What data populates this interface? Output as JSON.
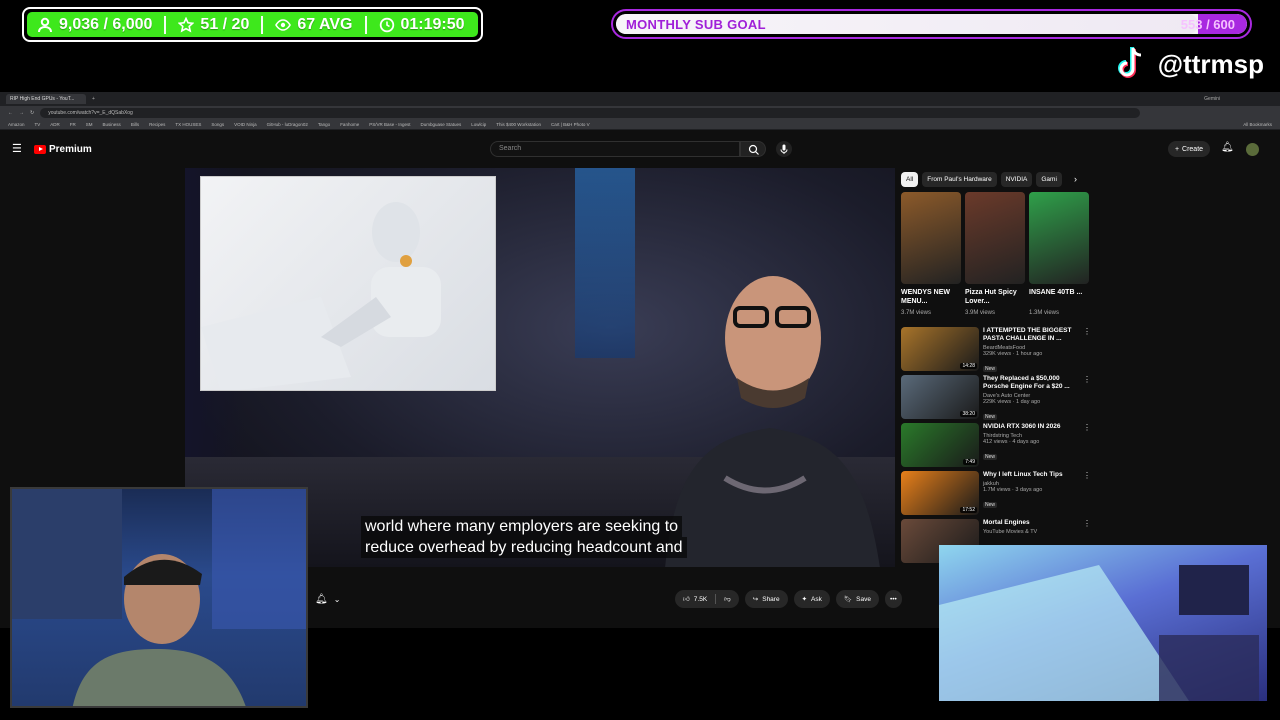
{
  "overlay": {
    "stats": {
      "followers": "9,036 / 6,000",
      "stars": "51 / 20",
      "viewers": "67 AVG",
      "uptime": "01:19:50"
    },
    "sub_goal": {
      "label": "MONTHLY SUB GOAL",
      "count": "553 / 600",
      "progress": 0.9217
    },
    "tiktok_handle": "@ttrmsp"
  },
  "browser": {
    "tab_title": "RIP High End GPUs - YouT...",
    "url": "youtube.com/watch?v=_E_dQSabXog",
    "bookmarks": [
      "Amazon",
      "TV",
      "ADR",
      "FR",
      "SM",
      "Business",
      "Bills",
      "Recipes",
      "TX HOUSES",
      "Songs",
      "VOID Ninja",
      "GitHub - luDragon02",
      "Tango",
      "Fanhome",
      "PS/VR Base - Ingest",
      "Dumbguase Statues",
      "Lowlcip",
      "This $400 Workstation",
      "Cart | B&H Photo V"
    ],
    "right_tab": "Gemini",
    "all_bookmarks": "All Bookmarks"
  },
  "youtube": {
    "logo": "Premium",
    "search_placeholder": "Search",
    "create_label": "Create",
    "subtitle_line1": "world where many employers are seeking to",
    "subtitle_line2": "reduce overhead by reducing headcount and",
    "likes": "7.5K",
    "share": "Share",
    "ask": "Ask",
    "save": "Save",
    "chips": [
      "All",
      "From Paul's Hardware",
      "NVIDIA",
      "Gami"
    ],
    "shorts": [
      {
        "title": "WENDYS NEW MENU...",
        "views": "3.7M views",
        "color": "#8c5a2a"
      },
      {
        "title": "Pizza Hut Spicy Lover...",
        "views": "3.9M views",
        "color": "#6b3a2a"
      },
      {
        "title": "INSANE 40TB ...",
        "views": "1.3M views",
        "color": "#2fa04a"
      }
    ],
    "recommendations": [
      {
        "title": "I ATTEMPTED THE BIGGEST PASTA CHALLENGE IN ...",
        "channel": "BeardMeatsFood",
        "meta": "329K views · 1 hour ago",
        "new": "New",
        "duration": "14:28",
        "color": "#a8742a"
      },
      {
        "title": "They Replaced a $50,000 Porsche Engine For a $20 ...",
        "channel": "Dave's Auto Center",
        "meta": "229K views · 1 day ago",
        "new": "New",
        "duration": "38:20",
        "color": "#5a6a7a"
      },
      {
        "title": "NVIDIA RTX 3060 IN 2026",
        "channel": "Thirdstring Tech",
        "meta": "412 views · 4 days ago",
        "new": "New",
        "duration": "7:49",
        "color": "#2a7a2a"
      },
      {
        "title": "Why I left Linux Tech Tips",
        "channel": "jakkuh",
        "meta": "1.7M views · 3 days ago",
        "new": "New",
        "duration": "17:52",
        "color": "#e8801a"
      },
      {
        "title": "Mortal Engines",
        "channel": "YouTube Movies & TV",
        "meta": "",
        "new": "",
        "duration": "",
        "color": "#6a4a3a"
      }
    ]
  }
}
